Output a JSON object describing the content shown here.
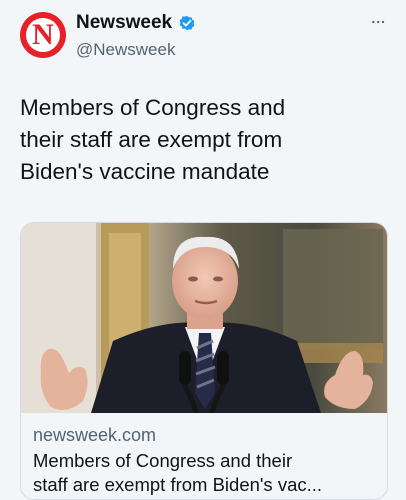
{
  "account": {
    "name": "Newsweek",
    "handle": "@Newsweek",
    "avatar_letter": "N",
    "brand_color": "#e8202a",
    "verified_color": "#1d9bf0",
    "verified_icon": "verified-badge-icon"
  },
  "menu": {
    "more_label": "..."
  },
  "tweet": {
    "lines": [
      "Members of Congress and",
      "their staff are exempt from",
      "Biden's vaccine mandate"
    ]
  },
  "card": {
    "domain": "newsweek.com",
    "title_lines": [
      "Members of Congress and their",
      "staff are exempt from Biden's vac..."
    ]
  }
}
